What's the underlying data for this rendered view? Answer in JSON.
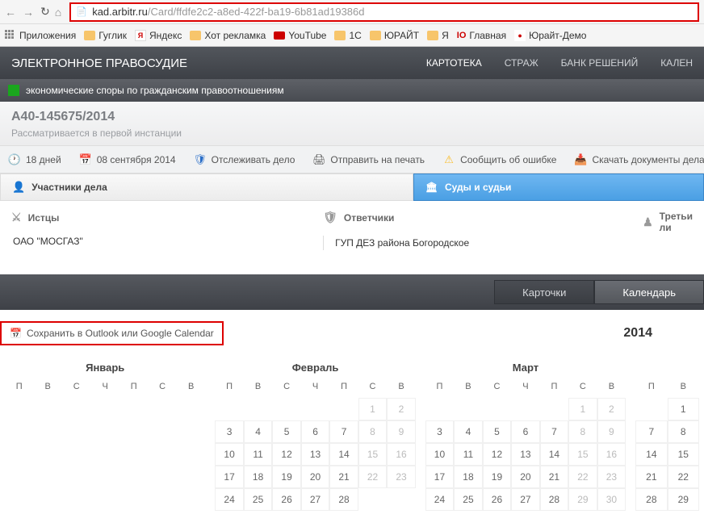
{
  "browser": {
    "url_host": "kad.arbitr.ru",
    "url_path": "/Card/ffdfe2c2-a8ed-422f-ba19-6b81ad19386d"
  },
  "bookmarks": {
    "apps": "Приложения",
    "items": [
      "Гуглик",
      "Яндекс",
      "Хот рекламка",
      "YouTube",
      "1С",
      "ЮРАЙТ",
      "Я",
      "Главная",
      "Юрайт-Демо"
    ]
  },
  "topnav": {
    "brand": "ЭЛЕКТРОННОЕ ПРАВОСУДИЕ",
    "menu": [
      "КАРТОТЕКА",
      "СТРАЖ",
      "БАНК РЕШЕНИЙ",
      "КАЛЕН"
    ]
  },
  "category": "экономические споры по гражданским правоотношениям",
  "case": {
    "number": "А40-145675/2014",
    "status": "Рассматривается в первой инстанции"
  },
  "actions": {
    "days": "18 дней",
    "date": "08 сентября 2014",
    "track": "Отслеживать дело",
    "print": "Отправить на печать",
    "error": "Сообщить об ошибке",
    "download": "Скачать документы дела"
  },
  "party_tabs": {
    "participants": "Участники дела",
    "courts": "Суды и судьи"
  },
  "parties": {
    "plaintiffs_label": "Истцы",
    "defendants_label": "Ответчики",
    "third_label": "Третьи ли",
    "plaintiff": "ОАО \"МОСГАЗ\"",
    "defendant": "ГУП ДЕЗ района Богородское"
  },
  "viewtabs": {
    "cards": "Карточки",
    "calendar": "Календарь"
  },
  "calendar": {
    "save": "Сохранить в Outlook или Google Calendar",
    "year": "2014",
    "months": [
      "Январь",
      "Февраль",
      "Март"
    ],
    "dow": [
      "П",
      "В",
      "С",
      "Ч",
      "П",
      "С",
      "В"
    ],
    "dow_partial": [
      "П",
      "В"
    ],
    "jan": [
      [
        "",
        "",
        "",
        "",
        "",
        "",
        ""
      ],
      [
        "",
        "",
        "",
        "",
        "",
        "",
        ""
      ],
      [
        "",
        "",
        "",
        "",
        "",
        "",
        ""
      ],
      [
        "",
        "",
        "",
        "",
        "",
        "",
        ""
      ],
      [
        "",
        "",
        "",
        "",
        "",
        "",
        ""
      ]
    ],
    "feb_weeks": [
      [
        "",
        "",
        "",
        "",
        "",
        "1",
        "2"
      ],
      [
        "3",
        "4",
        "5",
        "6",
        "7",
        "8",
        "9"
      ],
      [
        "10",
        "11",
        "12",
        "13",
        "14",
        "15",
        "16"
      ],
      [
        "17",
        "18",
        "19",
        "20",
        "21",
        "22",
        "23"
      ],
      [
        "24",
        "25",
        "26",
        "27",
        "28",
        "",
        ""
      ]
    ],
    "mar_weeks": [
      [
        "",
        "",
        "",
        "",
        "",
        "1",
        "2"
      ],
      [
        "3",
        "4",
        "5",
        "6",
        "7",
        "8",
        "9"
      ],
      [
        "10",
        "11",
        "12",
        "13",
        "14",
        "15",
        "16"
      ],
      [
        "17",
        "18",
        "19",
        "20",
        "21",
        "22",
        "23"
      ],
      [
        "24",
        "25",
        "26",
        "27",
        "28",
        "29",
        "30"
      ]
    ],
    "apr_partial": [
      [
        "",
        "1"
      ],
      [
        "7",
        "8"
      ],
      [
        "14",
        "15"
      ],
      [
        "21",
        "22"
      ],
      [
        "28",
        "29"
      ]
    ]
  }
}
